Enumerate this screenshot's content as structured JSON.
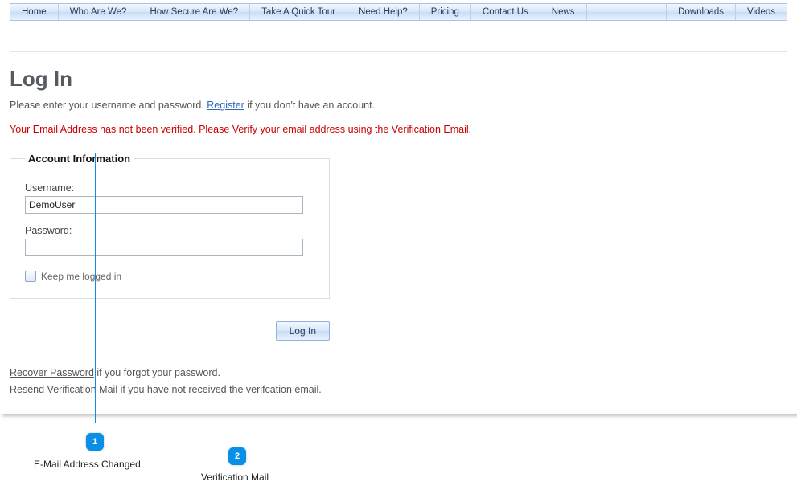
{
  "nav": {
    "items": [
      "Home",
      "Who Are We?",
      "How Secure Are We?",
      "Take A Quick Tour",
      "Need Help?",
      "Pricing",
      "Contact Us",
      "News"
    ],
    "right_items": [
      "Downloads",
      "Videos"
    ]
  },
  "title": "Log In",
  "intro_prefix": "Please enter your username and password. ",
  "register_link": "Register",
  "intro_suffix": " if you don't have an account.",
  "error_message": "Your Email Address has not been verified. Please Verify your email address using the Verification Email.",
  "fieldset_legend": "Account Information",
  "username_label": "Username:",
  "username_value": "DemoUser",
  "password_label": "Password:",
  "password_value": "",
  "keep_logged_in_label": "Keep me logged in",
  "login_button": "Log In",
  "recover_link": "Recover Password",
  "recover_suffix": " if you forgot your password.",
  "resend_link": "Resend Verification Mail",
  "resend_suffix": " if you have not received the verifcation email.",
  "callouts": [
    {
      "num": "1",
      "label": "E-Mail Address Changed"
    },
    {
      "num": "2",
      "label": "Verification Mail"
    }
  ]
}
